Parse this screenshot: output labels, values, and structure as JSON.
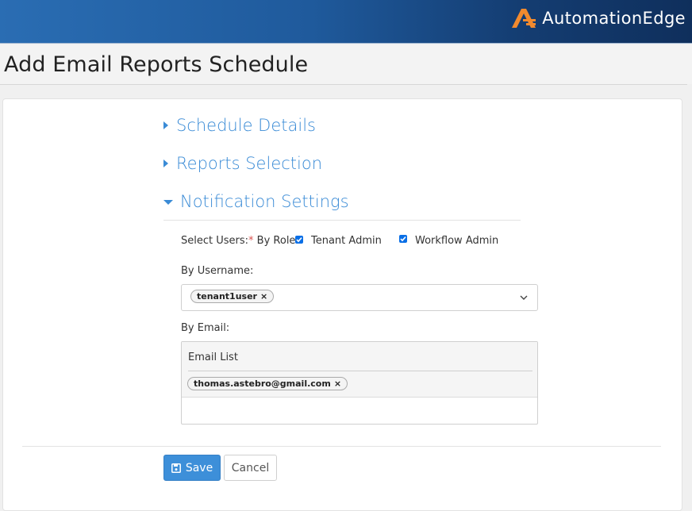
{
  "header": {
    "brand": "AutomationEdge",
    "brand_color": "#f28a2e",
    "logo_icon": "automationedge-logo-icon"
  },
  "page": {
    "title": "Add Email Reports Schedule"
  },
  "sections": [
    {
      "label": "Schedule Details",
      "expanded": false
    },
    {
      "label": "Reports Selection",
      "expanded": false
    },
    {
      "label": "Notification Settings",
      "expanded": true
    }
  ],
  "notification": {
    "select_users_label": "Select Users:",
    "required_mark": "*",
    "by_role_label": "By Role:",
    "roles": [
      {
        "label": "Tenant Admin",
        "checked": true
      },
      {
        "label": "Workflow Admin",
        "checked": true
      }
    ],
    "by_username_label": "By Username:",
    "usernames": [
      "tenant1user"
    ],
    "by_email_label": "By Email:",
    "email_list_label": "Email List",
    "emails": [
      "thomas.astebro@gmail.com"
    ],
    "email_input_value": ""
  },
  "actions": {
    "save_label": "Save",
    "cancel_label": "Cancel",
    "accent": "#3d8fd9"
  }
}
